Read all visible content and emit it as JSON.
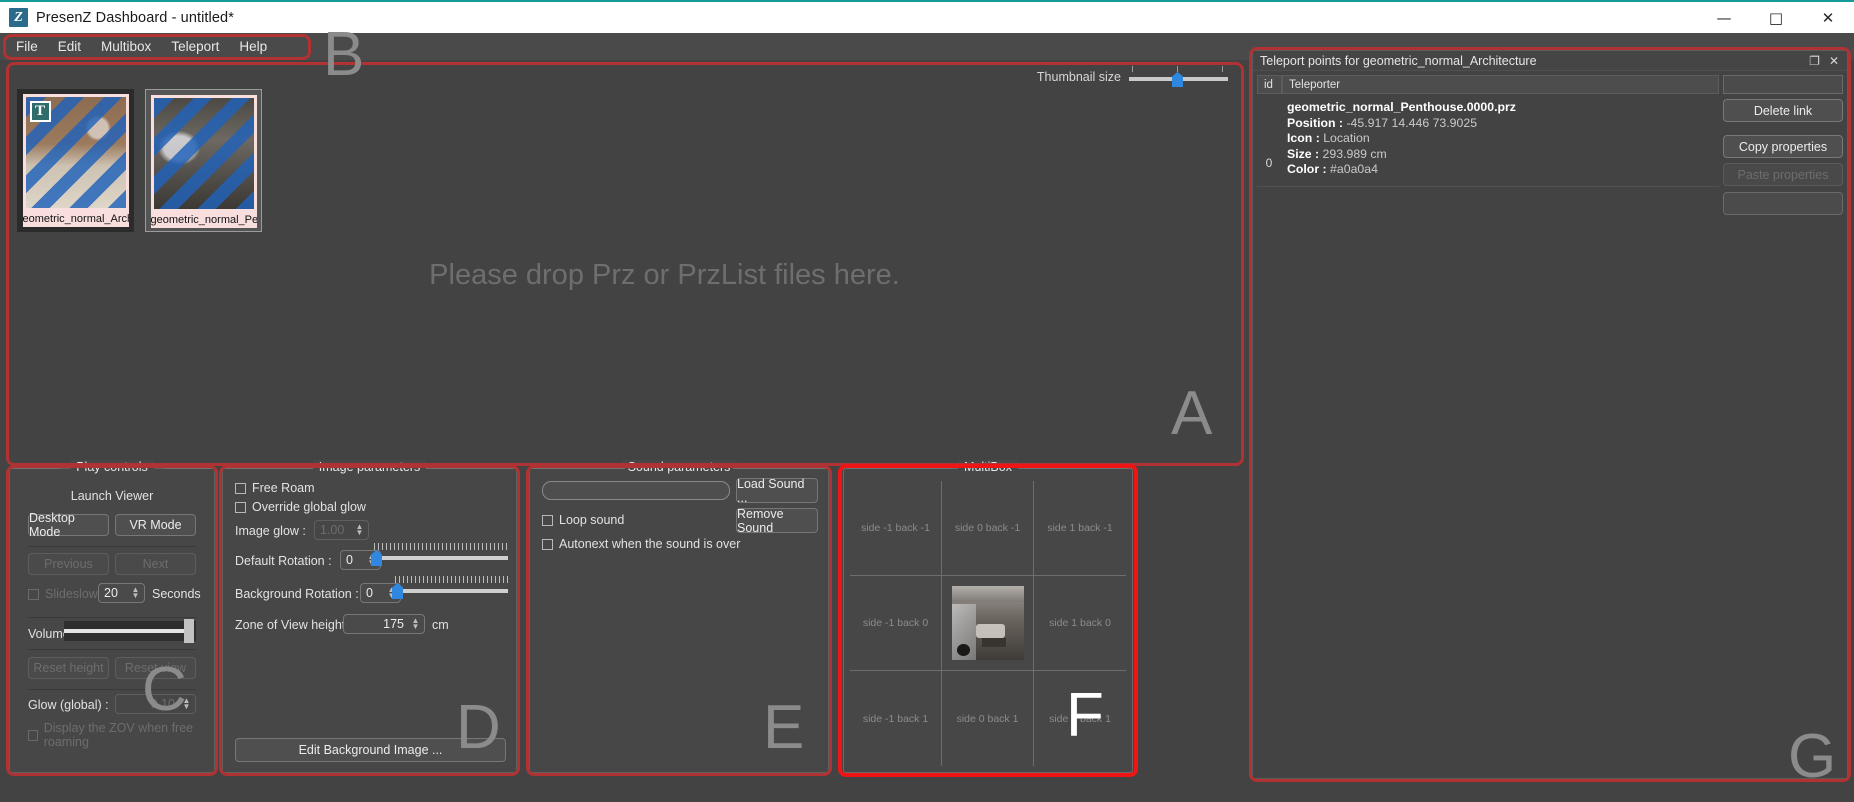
{
  "window": {
    "app_icon": "Z",
    "title": "PresenZ Dashboard - untitled*",
    "minimize": "—",
    "maximize": "□",
    "close": "✕"
  },
  "menubar": {
    "items": [
      {
        "label": "File"
      },
      {
        "label": "Edit"
      },
      {
        "label": "Multibox"
      },
      {
        "label": "Teleport"
      },
      {
        "label": "Help"
      }
    ]
  },
  "annotations": {
    "a": "A",
    "b": "B",
    "c": "C",
    "d": "D",
    "e": "E",
    "f": "F",
    "g": "G"
  },
  "droparea": {
    "placeholder": "Please drop Prz or PrzList files here.",
    "thumbnail_size_label": "Thumbnail size",
    "thumbnail_size_value": 50,
    "thumbnails": [
      {
        "caption": "eometric_normal_Architectur",
        "badge": "T",
        "selected": false
      },
      {
        "caption": "geometric_normal_Penthouse",
        "badge": "",
        "selected": true
      }
    ]
  },
  "play_controls": {
    "title": "Play controls",
    "launch_viewer": "Launch Viewer",
    "desktop_mode": "Desktop Mode",
    "vr_mode": "VR Mode",
    "previous": "Previous",
    "next": "Next",
    "slideslow_label": "Slideslow",
    "slideslow_value": "20",
    "seconds_label": "Seconds",
    "volume_label": "Volume",
    "volume_value": 100,
    "reset_height": "Reset height",
    "reset_view": "Reset view",
    "glow_label": "Glow (global) :",
    "glow_value": "0.10",
    "zov_checkbox": "Display the ZOV when free roaming"
  },
  "image_parameters": {
    "title": "Image parameters",
    "free_roam": "Free Roam",
    "override_global_glow": "Override global glow",
    "image_glow_label": "Image glow :",
    "image_glow_value": "1.00",
    "default_rotation_label": "Default Rotation :",
    "default_rotation_value": "0",
    "background_rotation_label": "Background Rotation :",
    "background_rotation_value": "0",
    "zov_height_label": "Zone of View height :",
    "zov_height_value": "175",
    "zov_height_unit": "cm",
    "edit_background_image": "Edit Background Image ..."
  },
  "sound_parameters": {
    "title": "Sound parameters",
    "sound_path_value": "",
    "load_sound": "Load Sound ...",
    "remove_sound": "Remove Sound",
    "loop_sound": "Loop sound",
    "autonext": "Autonext when the sound is over"
  },
  "multibox": {
    "title": "MultiBox",
    "cells": [
      {
        "label": "side -1 back -1",
        "has_preview": false
      },
      {
        "label": "side 0 back -1",
        "has_preview": false
      },
      {
        "label": "side 1 back -1",
        "has_preview": false
      },
      {
        "label": "side -1 back 0",
        "has_preview": false
      },
      {
        "label": "",
        "has_preview": true
      },
      {
        "label": "side 1 back 0",
        "has_preview": false
      },
      {
        "label": "side -1 back 1",
        "has_preview": false
      },
      {
        "label": "side 0 back 1",
        "has_preview": false
      },
      {
        "label": "side 1 back 1",
        "has_preview": false
      }
    ]
  },
  "teleport": {
    "panel_title": "Teleport points for geometric_normal_Architecture",
    "float_icon": "❐",
    "close_icon": "✕",
    "columns": [
      "id",
      "Teleporter",
      ""
    ],
    "rows": [
      {
        "id": "0",
        "file": "geometric_normal_Penthouse.0000.prz",
        "position_label": "Position :",
        "position_value": "-45.917 14.446 73.9025",
        "icon_label": "Icon :",
        "icon_value": "Location",
        "size_label": "Size :",
        "size_value": "293.989 cm",
        "color_label": "Color :",
        "color_value": "#a0a0a4"
      }
    ],
    "buttons": {
      "delete_link": "Delete link",
      "copy_properties": "Copy properties",
      "paste_properties": "Paste properties"
    }
  },
  "colors": {
    "background": "#434343",
    "panel": "#474747",
    "accent_blue": "#2f87e0",
    "annotation_red": "#b03232",
    "annotation_red_bright": "#f01515",
    "title_accent": "#169b9b"
  }
}
